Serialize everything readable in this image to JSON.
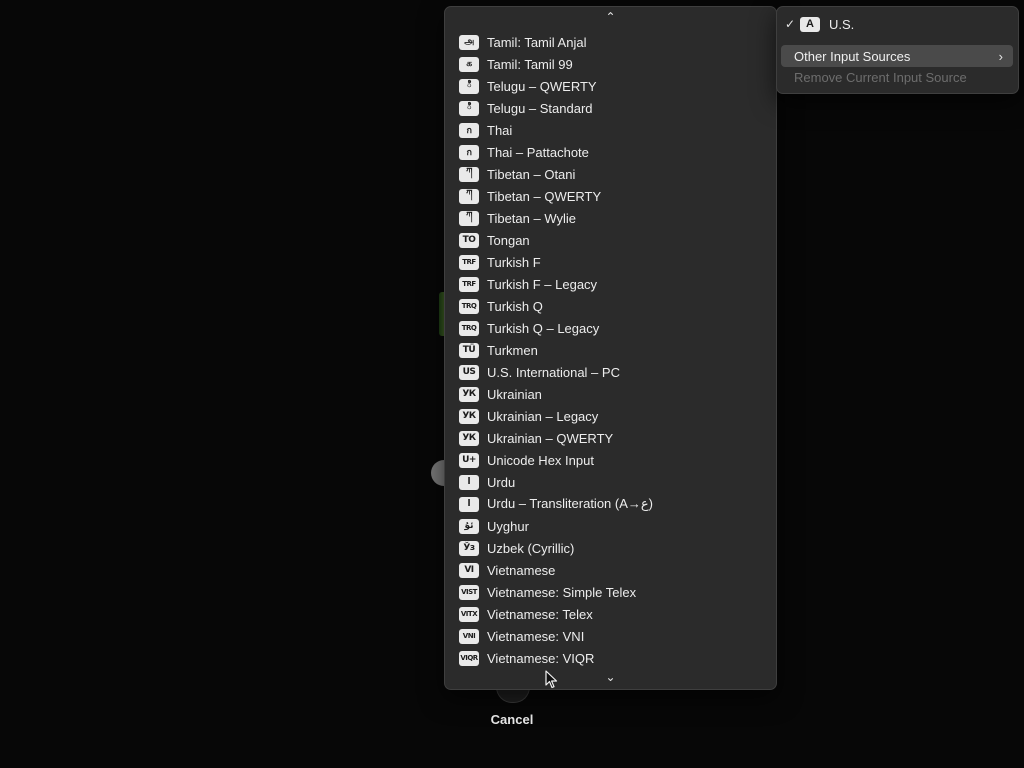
{
  "background": {
    "cancel_label": "Cancel"
  },
  "input_menu": {
    "current_source": {
      "check": "✓",
      "icon_text": "A",
      "label": "U.S."
    },
    "other_sources_label": "Other Input Sources",
    "other_sources_chevron": "›",
    "remove_label": "Remove Current Input Source"
  },
  "submenu": {
    "scroll_up_icon": "⌃",
    "scroll_down_icon": "⌄",
    "items": [
      {
        "icon": "அ",
        "label": "Tamil: Tamil Anjal"
      },
      {
        "icon": "க",
        "label": "Tamil: Tamil 99"
      },
      {
        "icon": "ి",
        "label": "Telugu – QWERTY"
      },
      {
        "icon": "ి",
        "label": "Telugu – Standard"
      },
      {
        "icon": "ก",
        "label": "Thai"
      },
      {
        "icon": "ก",
        "label": "Thai – Pattachote"
      },
      {
        "icon": "ཀ",
        "label": "Tibetan – Otani"
      },
      {
        "icon": "ཀ",
        "label": "Tibetan – QWERTY"
      },
      {
        "icon": "ཀ",
        "label": "Tibetan – Wylie"
      },
      {
        "icon": "TO",
        "label": "Tongan"
      },
      {
        "icon": "TRF",
        "label": "Turkish F"
      },
      {
        "icon": "TRF",
        "label": "Turkish F – Legacy"
      },
      {
        "icon": "TRQ",
        "label": "Turkish Q"
      },
      {
        "icon": "TRQ",
        "label": "Turkish Q – Legacy"
      },
      {
        "icon": "TÜ",
        "label": "Turkmen"
      },
      {
        "icon": "US",
        "label": "U.S. International – PC"
      },
      {
        "icon": "УК",
        "label": "Ukrainian"
      },
      {
        "icon": "УК",
        "label": "Ukrainian – Legacy"
      },
      {
        "icon": "УК",
        "label": "Ukrainian – QWERTY"
      },
      {
        "icon": "U+",
        "label": "Unicode Hex Input"
      },
      {
        "icon": "ا",
        "label": "Urdu"
      },
      {
        "icon": "ا",
        "label": "Urdu – Transliteration (A→ع)"
      },
      {
        "icon": "ئۇ",
        "label": "Uyghur"
      },
      {
        "icon": "Ўз",
        "label": "Uzbek (Cyrillic)"
      },
      {
        "icon": "VI",
        "label": "Vietnamese"
      },
      {
        "icon": "VIST",
        "label": "Vietnamese: Simple Telex"
      },
      {
        "icon": "VITX",
        "label": "Vietnamese: Telex"
      },
      {
        "icon": "VNI",
        "label": "Vietnamese: VNI"
      },
      {
        "icon": "VIQR",
        "label": "Vietnamese: VIQR"
      }
    ]
  }
}
